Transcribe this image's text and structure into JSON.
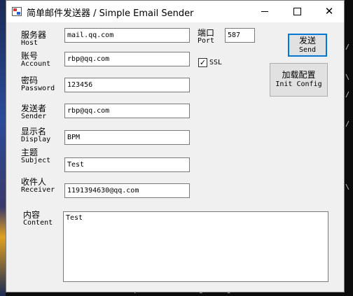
{
  "window": {
    "title": "简单邮件发送器 / Simple Email Sender"
  },
  "fields": {
    "host": {
      "zh": "服务器",
      "en": "Host",
      "value": "mail.qq.com"
    },
    "account": {
      "zh": "账号",
      "en": "Account",
      "value": "rbp@qq.com"
    },
    "password": {
      "zh": "密码",
      "en": "Password",
      "value": "123456"
    },
    "sender": {
      "zh": "发送者",
      "en": "Sender",
      "value": "rbp@qq.com"
    },
    "display": {
      "zh": "显示名",
      "en": "Display",
      "value": "BPM"
    },
    "subject": {
      "zh": "主题",
      "en": "Subject",
      "value": "Test"
    },
    "receiver": {
      "zh": "收件人",
      "en": "Receiver",
      "value": "1191394630@qq.com"
    },
    "port": {
      "zh": "端口",
      "en": "Port",
      "value": "587"
    },
    "content": {
      "zh": "内容",
      "en": "Content",
      "value": "Test"
    }
  },
  "ssl": {
    "label": "SSL",
    "checked": true,
    "mark": "✓"
  },
  "buttons": {
    "send": {
      "zh": "发送",
      "en": "Send"
    },
    "init": {
      "zh": "加载配置",
      "en": "Init Config"
    }
  },
  "background": {
    "console_text": "D:\\Git-MC\\SimpleMailSender>git tag",
    "console_edge": [
      "/",
      "\\",
      "/",
      "/",
      "\\"
    ]
  },
  "icons": {
    "minimize": "minimize-icon",
    "maximize": "maximize-icon",
    "close": "close-icon",
    "app": "app-icon",
    "check": "checkmark-icon"
  }
}
